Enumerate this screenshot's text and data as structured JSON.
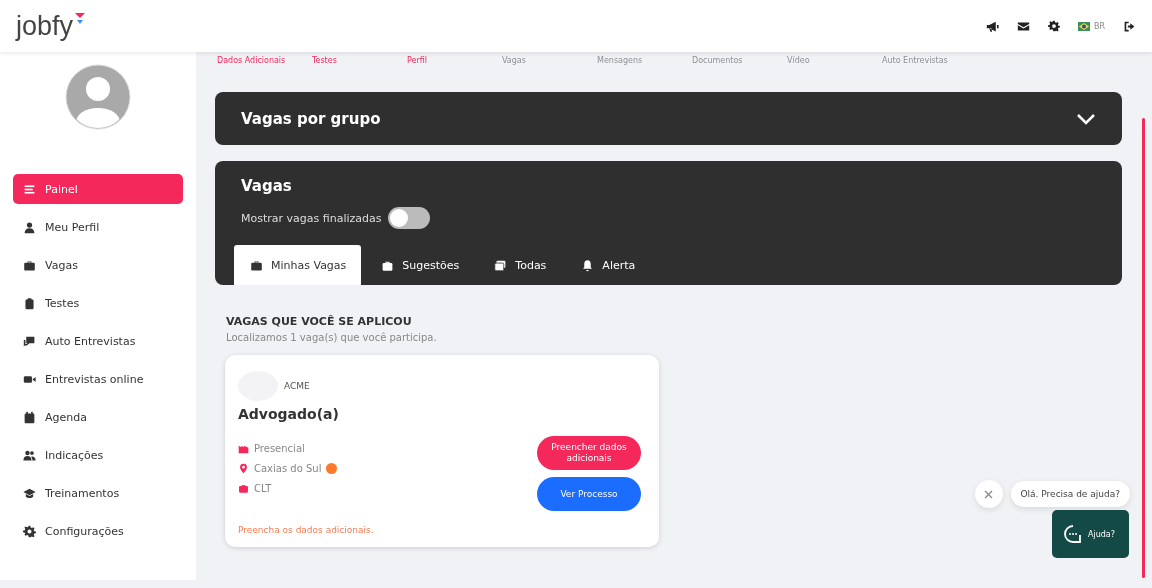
{
  "header": {
    "logo": "jobfy",
    "language": "BR"
  },
  "sidebar": {
    "items": [
      {
        "label": "Painel",
        "selected": true
      },
      {
        "label": "Meu Perfil",
        "selected": false
      },
      {
        "label": "Vagas",
        "selected": false
      },
      {
        "label": "Testes",
        "selected": false
      },
      {
        "label": "Auto Entrevistas",
        "selected": false
      },
      {
        "label": "Entrevistas online",
        "selected": false
      },
      {
        "label": "Agenda",
        "selected": false
      },
      {
        "label": "Indicações",
        "selected": false
      },
      {
        "label": "Treinamentos",
        "selected": false
      },
      {
        "label": "Configurações",
        "selected": false
      }
    ]
  },
  "subnav": [
    {
      "label": "Dados Adicionais",
      "highlighted": true
    },
    {
      "label": "Testes",
      "highlighted": true
    },
    {
      "label": "Perfil",
      "highlighted": true
    },
    {
      "label": "Vagas",
      "highlighted": false
    },
    {
      "label": "Mensagens",
      "highlighted": false
    },
    {
      "label": "Documentos",
      "highlighted": false
    },
    {
      "label": "Vídeo",
      "highlighted": false
    },
    {
      "label": "Auto Entrevistas",
      "highlighted": false
    }
  ],
  "group_panel": {
    "title": "Vagas por grupo",
    "expanded": false
  },
  "jobs_panel": {
    "title": "Vagas",
    "toggle_label": "Mostrar vagas finalizadas",
    "toggle_on": false,
    "tabs": [
      {
        "label": "Minhas Vagas",
        "selected": true
      },
      {
        "label": "Sugestões",
        "selected": false
      },
      {
        "label": "Todas",
        "selected": false
      },
      {
        "label": "Alerta",
        "selected": false
      }
    ]
  },
  "section": {
    "title": "VAGAS QUE VOCÊ SE APLICOU",
    "subtitle": "Localizamos 1 vaga(s) que você participa."
  },
  "job_card": {
    "company": "ACME",
    "title": "Advogado(a)",
    "details": [
      {
        "kind": "mode",
        "text": "Presencial"
      },
      {
        "kind": "location",
        "text": "Caxias do Sul"
      },
      {
        "kind": "contract",
        "text": "CLT"
      }
    ],
    "note": "Preencha os dados adicionais.",
    "buttons": [
      {
        "kind": "primary",
        "label": "Preencher dados adicionais"
      },
      {
        "kind": "secondary",
        "label": "Ver Processo"
      }
    ]
  },
  "chat": {
    "bubble": "Olá. Precisa de ajuda?",
    "button": "Ajuda?"
  }
}
